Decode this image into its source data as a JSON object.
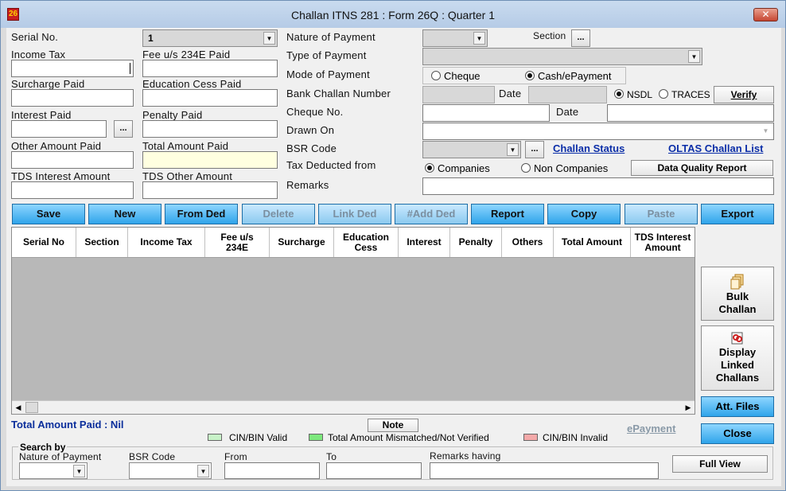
{
  "window": {
    "title": "Challan ITNS 281 : Form 26Q : Quarter 1",
    "icon_text": "26",
    "close": "✕"
  },
  "left_fields": {
    "serial_no": {
      "label": "Serial No.",
      "value": "1"
    },
    "income_tax": "Income Tax",
    "fee_234e": "Fee u/s 234E Paid",
    "surcharge": "Surcharge Paid",
    "education_cess": "Education Cess Paid",
    "interest": "Interest Paid",
    "penalty": "Penalty Paid",
    "other_amount": "Other Amount Paid",
    "total_amount": "Total Amount Paid",
    "tds_interest": "TDS Interest Amount",
    "tds_other": "TDS Other Amount"
  },
  "right_fields": {
    "nature_of_payment": "Nature of Payment",
    "section": "Section",
    "type_of_payment": "Type of Payment",
    "mode_of_payment": "Mode of Payment",
    "mode_cheque": "Cheque",
    "mode_cash": "Cash/ePayment",
    "bank_challan": "Bank Challan Number",
    "date": "Date",
    "nsdl": "NSDL",
    "traces": "TRACES",
    "verify": "Verify",
    "cheque_no": "Cheque No.",
    "date2": "Date",
    "drawn_on": "Drawn On",
    "bsr_code": "BSR Code",
    "challan_status": "Challan Status",
    "oltas": "OLTAS Challan List",
    "tax_deducted_from": "Tax Deducted from",
    "companies": "Companies",
    "non_companies": "Non Companies",
    "data_quality": "Data Quality Report",
    "remarks": "Remarks",
    "dots": "..."
  },
  "toolbar": [
    {
      "label": "Save",
      "enabled": true
    },
    {
      "label": "New",
      "enabled": true
    },
    {
      "label": "From Ded",
      "enabled": true
    },
    {
      "label": "Delete",
      "enabled": false
    },
    {
      "label": "Link Ded",
      "enabled": false
    },
    {
      "label": "#Add Ded",
      "enabled": false
    },
    {
      "label": "Report",
      "enabled": true
    },
    {
      "label": "Copy",
      "enabled": true
    },
    {
      "label": "Paste",
      "enabled": false
    },
    {
      "label": "Export",
      "enabled": true
    }
  ],
  "grid_columns": [
    "Serial No",
    "Section",
    "Income Tax",
    "Fee u/s\n234E",
    "Surcharge",
    "Education\nCess",
    "Interest",
    "Penalty",
    "Others",
    "Total Amount",
    "TDS Interest\nAmount"
  ],
  "side_buttons": {
    "bulk": "Bulk\nChallan",
    "linked": "Display\nLinked\nChallans",
    "att_files": "Att. Files",
    "close": "Close"
  },
  "footer": {
    "total": "Total Amount Paid : Nil",
    "note": "Note",
    "epayment": "ePayment",
    "legend": [
      {
        "label": "CIN/BIN Valid",
        "color": "#c8f2c8"
      },
      {
        "label": "Total Amount Mismatched/Not Verified",
        "color": "#7de87d"
      },
      {
        "label": "CIN/BIN Invalid",
        "color": "#f4a9a9"
      }
    ]
  },
  "search": {
    "title": "Search by",
    "nature": "Nature of Payment",
    "bsr": "BSR Code",
    "from": "From",
    "to": "To",
    "remarks": "Remarks having",
    "full_view": "Full View"
  }
}
